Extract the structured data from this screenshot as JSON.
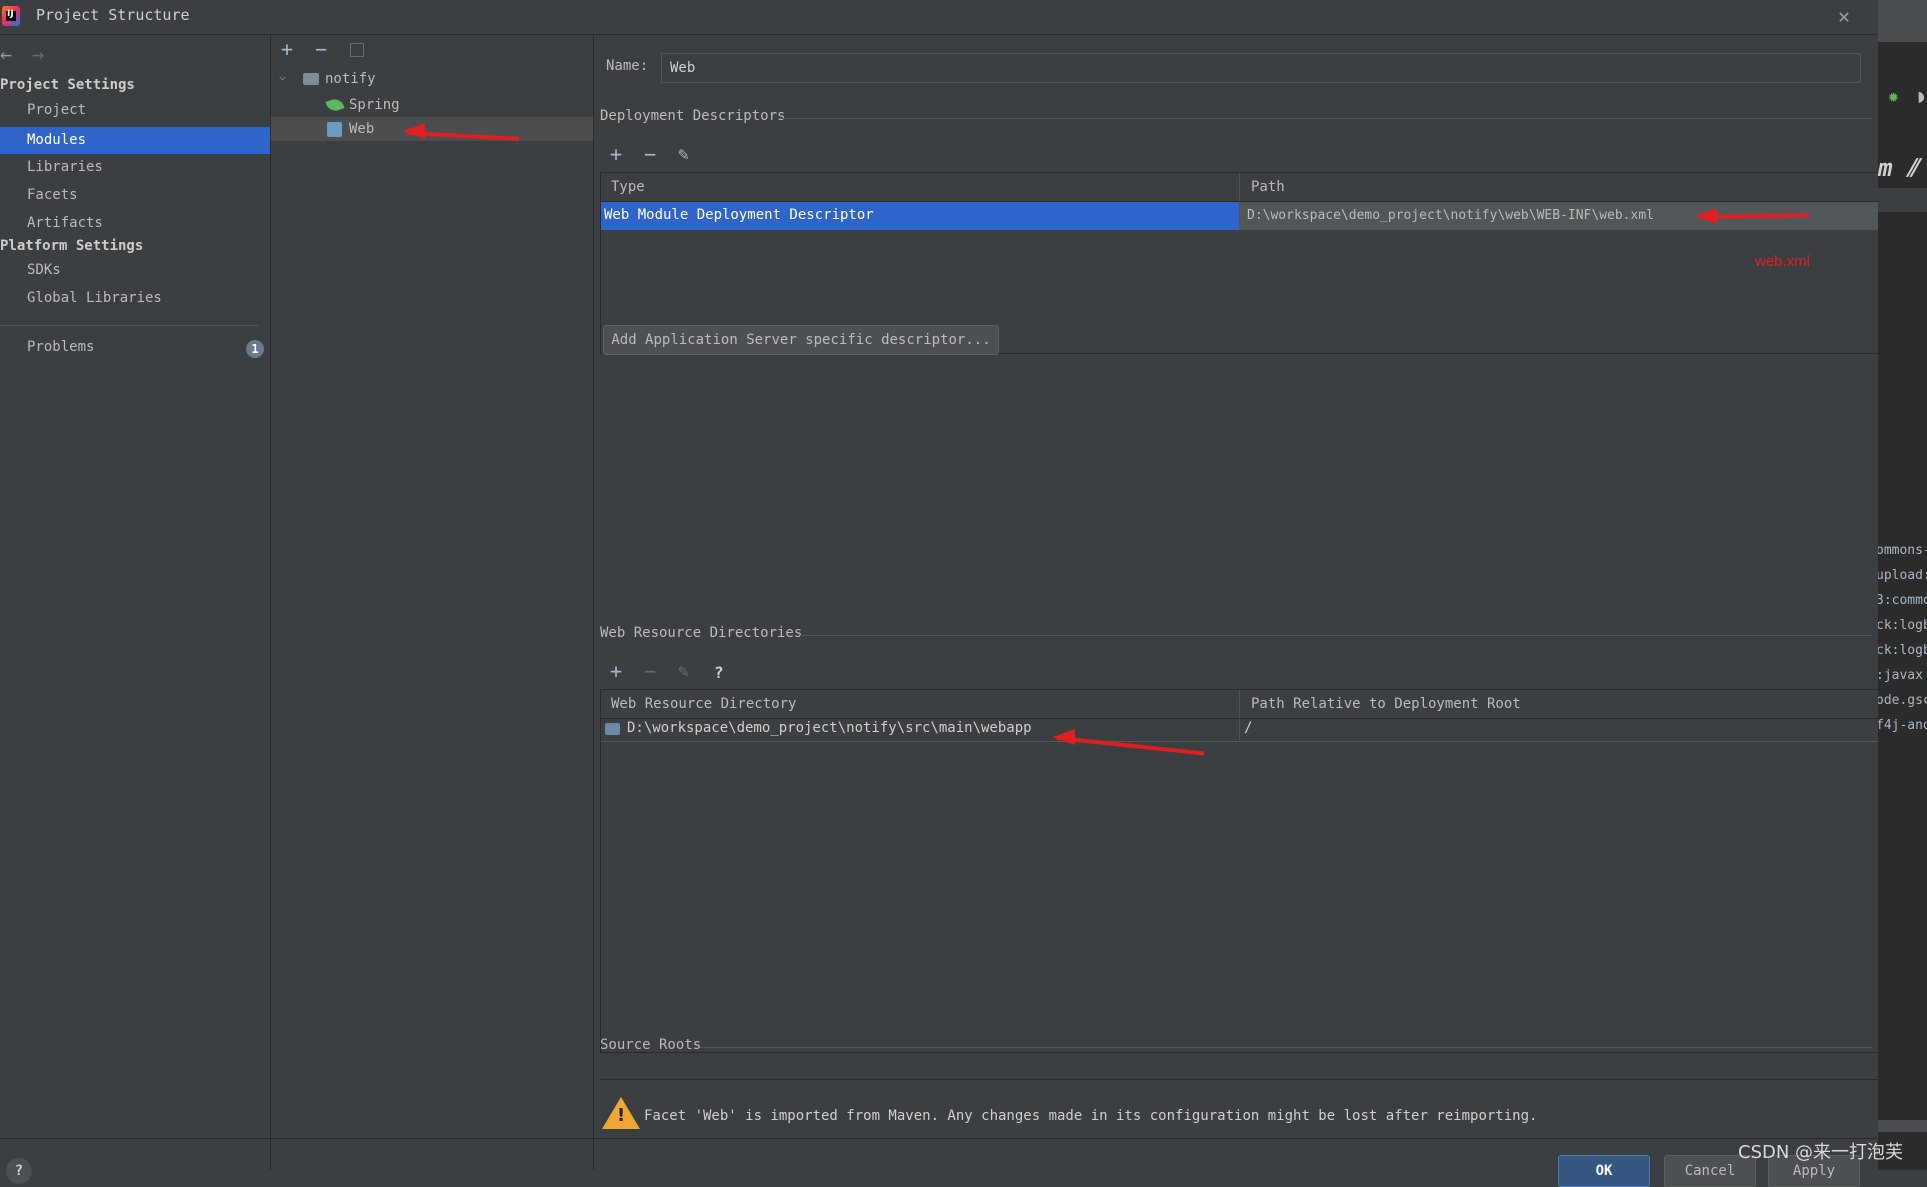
{
  "window": {
    "title": "Project Structure"
  },
  "left_nav": {
    "project_settings_header": "Project Settings",
    "project_items": [
      {
        "label": "Project"
      },
      {
        "label": "Modules"
      },
      {
        "label": "Libraries"
      },
      {
        "label": "Facets"
      },
      {
        "label": "Artifacts"
      }
    ],
    "platform_settings_header": "Platform Settings",
    "platform_items": [
      {
        "label": "SDKs"
      },
      {
        "label": "Global Libraries"
      }
    ],
    "problems": {
      "label": "Problems",
      "count": "1"
    }
  },
  "module_tree": {
    "root": "notify",
    "children": [
      "Spring",
      "Web"
    ],
    "selected": "Web"
  },
  "module_settings": {
    "name_label": "Name:",
    "name_value": "Web",
    "deployment_descriptors": {
      "title": "Deployment Descriptors",
      "columns": [
        "Type",
        "Path"
      ],
      "rows": [
        {
          "type": "Web Module Deployment Descriptor",
          "path": "D:\\workspace\\demo_project\\notify\\web\\WEB-INF\\web.xml"
        }
      ],
      "annotation": "web.xml",
      "add_server_button": "Add Application Server specific descriptor..."
    },
    "web_resource_directories": {
      "title": "Web Resource Directories",
      "help": "?",
      "columns": [
        "Web Resource Directory",
        "Path Relative to Deployment Root"
      ],
      "rows": [
        {
          "directory": "D:\\workspace\\demo_project\\notify\\src\\main\\webapp",
          "relative_path": "/"
        }
      ]
    },
    "source_roots": {
      "title": "Source Roots"
    },
    "warning": "Facet 'Web' is imported from Maven. Any changes made in its configuration might be lost after reimporting."
  },
  "dialog_buttons": {
    "ok": "OK",
    "cancel": "Cancel",
    "apply": "Apply"
  },
  "background_editor_lines": [
    "ommons-",
    "upload:",
    "3:commo",
    "ck:logb",
    "ck:logb",
    ":javax",
    "ode.gsc",
    "f4j-and"
  ],
  "watermark": "CSDN @来一打泡芙",
  "colors": {
    "selection": "#2f65ca",
    "annotation_red": "#e02020",
    "warning": "#f0a732"
  }
}
